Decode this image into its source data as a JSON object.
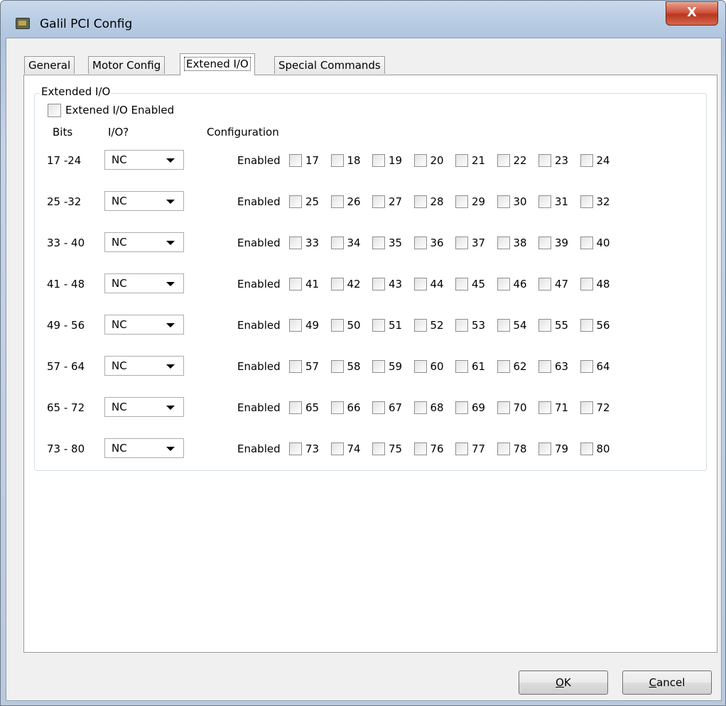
{
  "window": {
    "title": "Galil PCI Config",
    "close_glyph": "X"
  },
  "tabs": [
    {
      "label": "General"
    },
    {
      "label": "Motor Config"
    },
    {
      "label": "Extened I/O",
      "active": true
    },
    {
      "label": "Special Commands"
    }
  ],
  "group": {
    "title": "Extended I/O",
    "enable_label": "Extened I/O Enabled",
    "enable_checked": false,
    "headers": {
      "bits": "Bits",
      "io": "I/O?",
      "config": "Configuration"
    },
    "enabled_label": "Enabled",
    "rows": [
      {
        "range": "17 -24",
        "io": "NC",
        "bits": [
          "17",
          "18",
          "19",
          "20",
          "21",
          "22",
          "23",
          "24"
        ]
      },
      {
        "range": "25 -32",
        "io": "NC",
        "bits": [
          "25",
          "26",
          "27",
          "28",
          "29",
          "30",
          "31",
          "32"
        ]
      },
      {
        "range": "33 - 40",
        "io": "NC",
        "bits": [
          "33",
          "34",
          "35",
          "36",
          "37",
          "38",
          "39",
          "40"
        ]
      },
      {
        "range": "41 - 48",
        "io": "NC",
        "bits": [
          "41",
          "42",
          "43",
          "44",
          "45",
          "46",
          "47",
          "48"
        ]
      },
      {
        "range": "49 - 56",
        "io": "NC",
        "bits": [
          "49",
          "50",
          "51",
          "52",
          "53",
          "54",
          "55",
          "56"
        ]
      },
      {
        "range": "57 - 64",
        "io": "NC",
        "bits": [
          "57",
          "58",
          "59",
          "60",
          "61",
          "62",
          "63",
          "64"
        ]
      },
      {
        "range": "65 - 72",
        "io": "NC",
        "bits": [
          "65",
          "66",
          "67",
          "68",
          "69",
          "70",
          "71",
          "72"
        ]
      },
      {
        "range": "73 - 80",
        "io": "NC",
        "bits": [
          "73",
          "74",
          "75",
          "76",
          "77",
          "78",
          "79",
          "80"
        ]
      }
    ]
  },
  "buttons": {
    "ok": {
      "mnemonic": "O",
      "rest": "K"
    },
    "cancel": {
      "mnemonic": "C",
      "rest": "ancel"
    }
  },
  "colors": {
    "close_button": "#c8452c",
    "frame": "#b9cce4"
  }
}
